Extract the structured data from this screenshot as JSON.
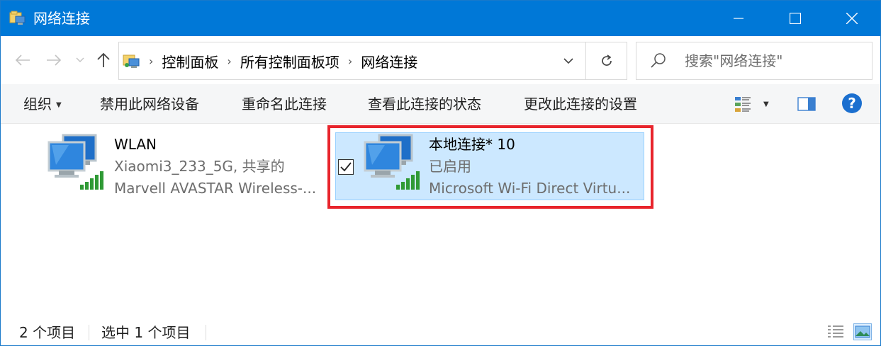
{
  "window": {
    "title": "网络连接"
  },
  "address": {
    "crumbs": [
      "控制面板",
      "所有控制面板项",
      "网络连接"
    ]
  },
  "search": {
    "placeholder": "搜索\"网络连接\""
  },
  "commands": {
    "organize": "组织",
    "disable": "禁用此网络设备",
    "rename": "重命名此连接",
    "view_status": "查看此连接的状态",
    "change_settings": "更改此连接的设置"
  },
  "items": [
    {
      "name": "WLAN",
      "network": "Xiaomi3_233_5G, 共享的",
      "adapter": "Marvell AVASTAR Wireless-..."
    },
    {
      "name": "本地连接* 10",
      "network": "已启用",
      "adapter": "Microsoft Wi-Fi Direct Virtu..."
    }
  ],
  "status": {
    "count": "2 个项目",
    "selected": "选中 1 个项目"
  },
  "icons": {
    "back": "arrow-left-icon",
    "forward": "arrow-right-icon",
    "up": "arrow-up-icon",
    "refresh": "refresh-icon",
    "search": "search-icon",
    "help": "help-icon",
    "network": "network-connection-icon"
  },
  "colors": {
    "titlebar": "#0078d7",
    "selection": "#cce8ff",
    "highlight_frame": "#e8242c",
    "help": "#1b6fcf"
  }
}
